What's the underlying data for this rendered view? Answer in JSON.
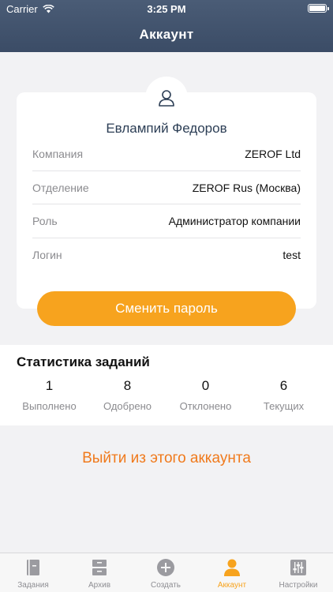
{
  "status_bar": {
    "carrier": "Carrier",
    "time": "3:25 PM"
  },
  "nav": {
    "title": "Аккаунт"
  },
  "profile": {
    "name": "Евлампий Федоров",
    "rows": [
      {
        "label": "Компания",
        "value": "ZEROF Ltd"
      },
      {
        "label": "Отделение",
        "value": "ZEROF Rus (Москва)"
      },
      {
        "label": "Роль",
        "value": "Администратор компании"
      },
      {
        "label": "Логин",
        "value": "test"
      }
    ],
    "change_password_label": "Сменить пароль"
  },
  "stats": {
    "title": "Статистика заданий",
    "items": [
      {
        "value": "1",
        "label": "Выполнено"
      },
      {
        "value": "8",
        "label": "Одобрено"
      },
      {
        "value": "0",
        "label": "Отклонено"
      },
      {
        "value": "6",
        "label": "Текущих"
      }
    ]
  },
  "logout_label": "Выйти из этого аккаунта",
  "tabs": [
    {
      "label": "Задания",
      "icon": "book-icon"
    },
    {
      "label": "Архив",
      "icon": "archive-icon"
    },
    {
      "label": "Создать",
      "icon": "plus-circle-icon"
    },
    {
      "label": "Аккаунт",
      "icon": "user-icon",
      "active": true
    },
    {
      "label": "Настройки",
      "icon": "sliders-icon"
    }
  ],
  "colors": {
    "accent": "#f7a31e",
    "logout": "#f07a1c",
    "header": "#3b4c66"
  }
}
